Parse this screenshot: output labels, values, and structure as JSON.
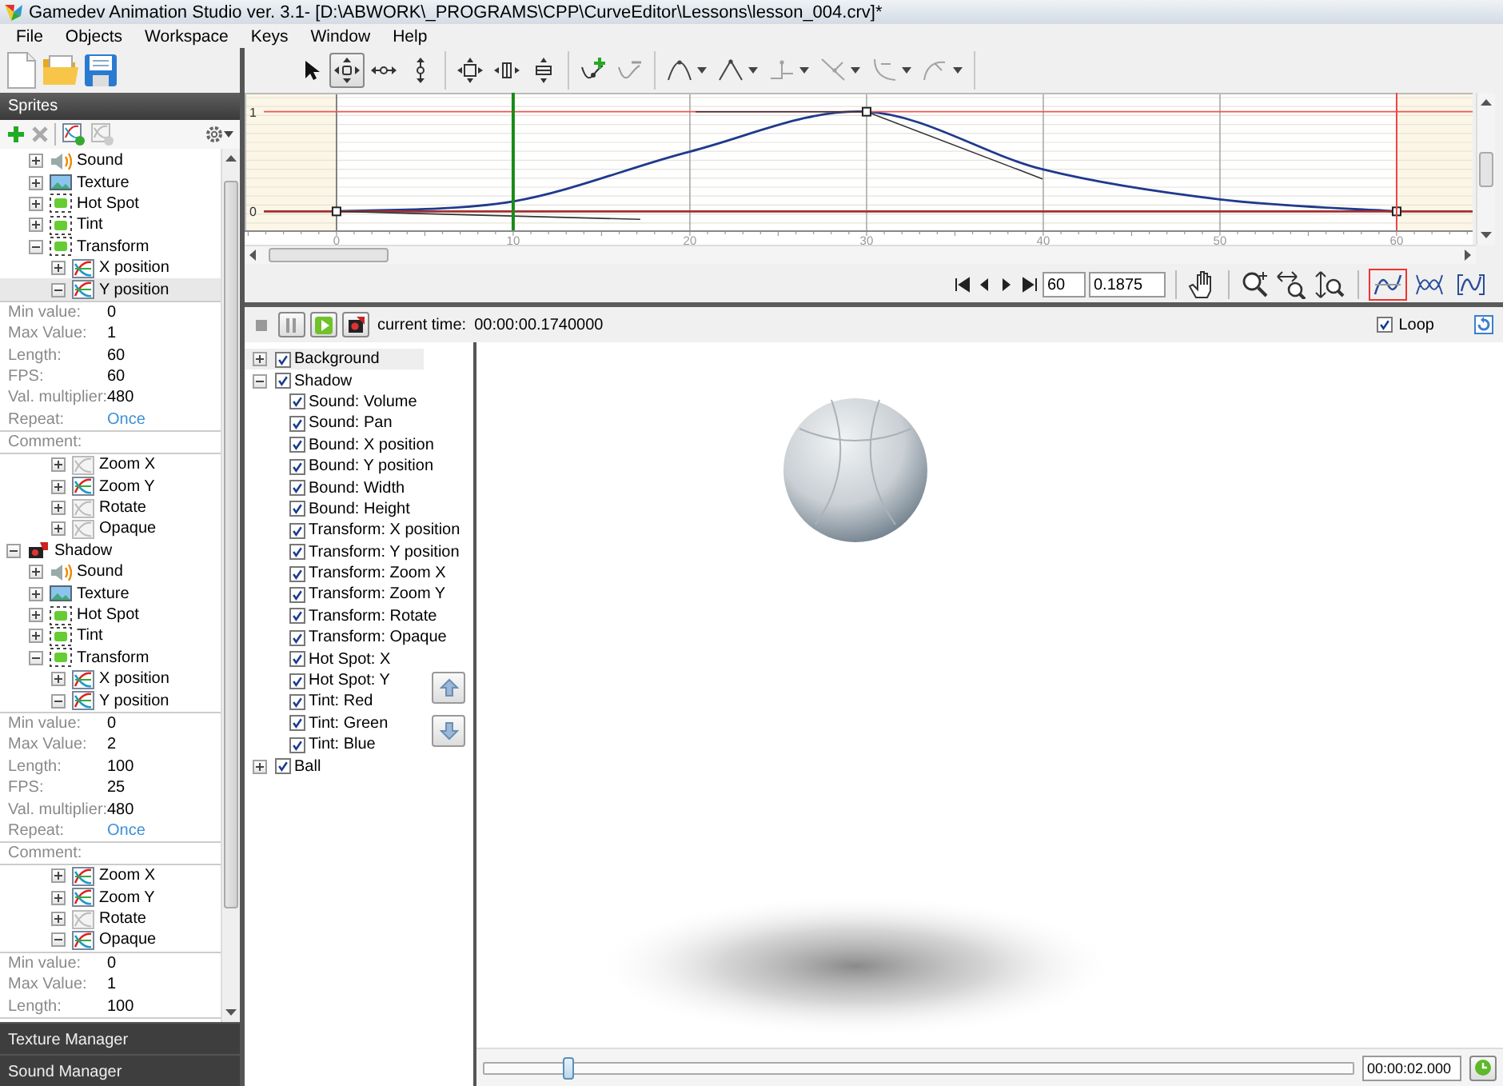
{
  "window": {
    "title": "Gamedev Animation Studio ver. 3.1- [D:\\ABWORK\\_PROGRAMS\\CPP\\CurveEditor\\Lessons\\lesson_004.crv]*"
  },
  "menu": [
    "File",
    "Objects",
    "Workspace",
    "Keys",
    "Window",
    "Help"
  ],
  "sprites_panel": {
    "title": "Sprites",
    "partial_items": [
      {
        "label": "Sound",
        "kind": "sound",
        "expanded": false,
        "selected": false
      },
      {
        "label": "Texture",
        "kind": "texture",
        "expanded": false,
        "selected": false
      },
      {
        "label": "Hot Spot",
        "kind": "hotspot",
        "expanded": false,
        "selected": false
      },
      {
        "label": "Tint",
        "kind": "tint",
        "expanded": false,
        "selected": false
      },
      {
        "label": "Transform",
        "kind": "transform",
        "expanded": true,
        "selected": false,
        "children": [
          {
            "label": "X position",
            "kind": "curve",
            "active": true,
            "expanded": false,
            "selected": false
          },
          {
            "label": "Y position",
            "kind": "curve",
            "active": true,
            "expanded": true,
            "selected": true,
            "properties": [
              {
                "label": "Min value:",
                "value": "0",
                "kind": "text"
              },
              {
                "label": "Max Value:",
                "value": "1",
                "kind": "text"
              },
              {
                "label": "Length:",
                "value": "60",
                "kind": "text"
              },
              {
                "label": "FPS:",
                "value": "60",
                "kind": "text"
              },
              {
                "label": "Val. multiplier:",
                "value": "480",
                "kind": "text"
              },
              {
                "label": "Repeat:",
                "value": "Once",
                "kind": "link"
              }
            ],
            "comment": "Comment:"
          },
          {
            "label": "Zoom X",
            "kind": "curve",
            "active": false,
            "expanded": false,
            "selected": false
          },
          {
            "label": "Zoom Y",
            "kind": "curve",
            "active": true,
            "expanded": false,
            "selected": false
          },
          {
            "label": "Rotate",
            "kind": "curve",
            "active": false,
            "expanded": false,
            "selected": false
          },
          {
            "label": "Opaque",
            "kind": "curve",
            "active": false,
            "expanded": false,
            "selected": false
          }
        ]
      }
    ],
    "items": [
      {
        "label": "Shadow",
        "kind": "sprite",
        "expanded": true,
        "selected": false,
        "children": [
          {
            "label": "Sound",
            "kind": "sound",
            "expanded": false,
            "selected": false
          },
          {
            "label": "Texture",
            "kind": "texture",
            "expanded": false,
            "selected": false
          },
          {
            "label": "Hot Spot",
            "kind": "hotspot",
            "expanded": false,
            "selected": false
          },
          {
            "label": "Tint",
            "kind": "tint",
            "expanded": false,
            "selected": false
          },
          {
            "label": "Transform",
            "kind": "transform",
            "expanded": true,
            "selected": false,
            "children": [
              {
                "label": "X position",
                "kind": "curve",
                "active": true,
                "expanded": false,
                "selected": false
              },
              {
                "label": "Y position",
                "kind": "curve",
                "active": true,
                "expanded": true,
                "selected": false,
                "properties": [
                  {
                    "label": "Min value:",
                    "value": "0",
                    "kind": "text"
                  },
                  {
                    "label": "Max Value:",
                    "value": "2",
                    "kind": "text"
                  },
                  {
                    "label": "Length:",
                    "value": "100",
                    "kind": "text"
                  },
                  {
                    "label": "FPS:",
                    "value": "25",
                    "kind": "text"
                  },
                  {
                    "label": "Val. multiplier:",
                    "value": "480",
                    "kind": "text"
                  },
                  {
                    "label": "Repeat:",
                    "value": "Once",
                    "kind": "link"
                  }
                ],
                "comment": "Comment:"
              },
              {
                "label": "Zoom X",
                "kind": "curve",
                "active": true,
                "expanded": false,
                "selected": false
              },
              {
                "label": "Zoom Y",
                "kind": "curve",
                "active": true,
                "expanded": false,
                "selected": false
              },
              {
                "label": "Rotate",
                "kind": "curve",
                "active": false,
                "expanded": false,
                "selected": false
              },
              {
                "label": "Opaque",
                "kind": "curve",
                "active": true,
                "expanded": true,
                "selected": false,
                "properties": [
                  {
                    "label": "Min value:",
                    "value": "0",
                    "kind": "text"
                  },
                  {
                    "label": "Max Value:",
                    "value": "1",
                    "kind": "text"
                  },
                  {
                    "label": "Length:",
                    "value": "100",
                    "kind": "text"
                  }
                ]
              }
            ]
          }
        ]
      }
    ],
    "managers": [
      "Texture Manager",
      "Sound Manager"
    ]
  },
  "curve_editor": {
    "tool_groups": [
      [
        {
          "kind": "pointer",
          "selected": false,
          "disabled": false
        },
        {
          "kind": "move",
          "selected": true,
          "disabled": false
        },
        {
          "kind": "move-h",
          "selected": false,
          "disabled": false
        },
        {
          "kind": "move-v",
          "selected": false,
          "disabled": false
        }
      ],
      [
        {
          "kind": "scale",
          "selected": false,
          "disabled": false
        },
        {
          "kind": "scale-h",
          "selected": false,
          "disabled": false
        },
        {
          "kind": "scale-v",
          "selected": false,
          "disabled": false
        }
      ],
      [
        {
          "kind": "add-point",
          "selected": false,
          "disabled": false
        },
        {
          "kind": "remove-point",
          "selected": false,
          "disabled": true
        }
      ],
      [
        {
          "kind": "smooth",
          "selected": false,
          "disabled": false
        },
        {
          "kind": "corner",
          "selected": false,
          "disabled": false
        },
        {
          "kind": "step",
          "selected": false,
          "disabled": true
        },
        {
          "kind": "linear",
          "selected": false,
          "disabled": true
        },
        {
          "kind": "ease",
          "selected": false,
          "disabled": true
        },
        {
          "kind": "bend",
          "selected": false,
          "disabled": true
        }
      ]
    ],
    "chart_data": {
      "type": "line",
      "x": [
        0,
        10,
        20,
        30,
        40,
        50,
        60
      ],
      "series": [
        {
          "color": "#1f3a8c",
          "values": [
            0,
            0.1,
            0.6,
            1,
            0.42,
            0.12,
            0
          ]
        }
      ],
      "xlim": [
        -5.2,
        64.3
      ],
      "ylim": [
        -0.19,
        1.19
      ],
      "grid": true,
      "xticks": [
        0,
        10,
        20,
        30,
        40,
        50,
        60
      ],
      "yticks": [
        0,
        1
      ]
    },
    "frame": "60",
    "value": "0.1875",
    "views": [
      {
        "kind": "curve",
        "selected": true
      },
      {
        "kind": "mirror",
        "selected": false
      },
      {
        "kind": "fit",
        "selected": false
      }
    ]
  },
  "player": {
    "current_time_label": "current time:",
    "current_time": "00:00:00.1740000",
    "loop": {
      "label": "Loop",
      "checked": true
    },
    "tracks": [
      {
        "label": "Background",
        "checked": true,
        "expanded": false,
        "selected": true
      },
      {
        "label": "Shadow",
        "checked": true,
        "expanded": true,
        "selected": false,
        "children": [
          {
            "label": "Sound: Volume",
            "checked": true,
            "selected": false
          },
          {
            "label": "Sound: Pan",
            "checked": true,
            "selected": false
          },
          {
            "label": "Bound: X position",
            "checked": true,
            "selected": false
          },
          {
            "label": "Bound: Y position",
            "checked": true,
            "selected": false
          },
          {
            "label": "Bound: Width",
            "checked": true,
            "selected": false
          },
          {
            "label": "Bound: Height",
            "checked": true,
            "selected": false
          },
          {
            "label": "Transform: X position",
            "checked": true,
            "selected": false
          },
          {
            "label": "Transform: Y position",
            "checked": true,
            "selected": false
          },
          {
            "label": "Transform: Zoom X",
            "checked": true,
            "selected": false
          },
          {
            "label": "Transform: Zoom Y",
            "checked": true,
            "selected": false
          },
          {
            "label": "Transform: Rotate",
            "checked": true,
            "selected": false
          },
          {
            "label": "Transform: Opaque",
            "checked": true,
            "selected": false
          },
          {
            "label": "Hot Spot: X",
            "checked": true,
            "selected": false
          },
          {
            "label": "Hot Spot: Y",
            "checked": true,
            "selected": false
          },
          {
            "label": "Tint: Red",
            "checked": true,
            "selected": false
          },
          {
            "label": "Tint: Green",
            "checked": true,
            "selected": false
          },
          {
            "label": "Tint: Blue",
            "checked": true,
            "selected": false
          }
        ]
      },
      {
        "label": "Ball",
        "checked": true,
        "expanded": false,
        "selected": false
      }
    ],
    "timeline": {
      "level": 0.095,
      "time": "00:00:02.000"
    }
  }
}
